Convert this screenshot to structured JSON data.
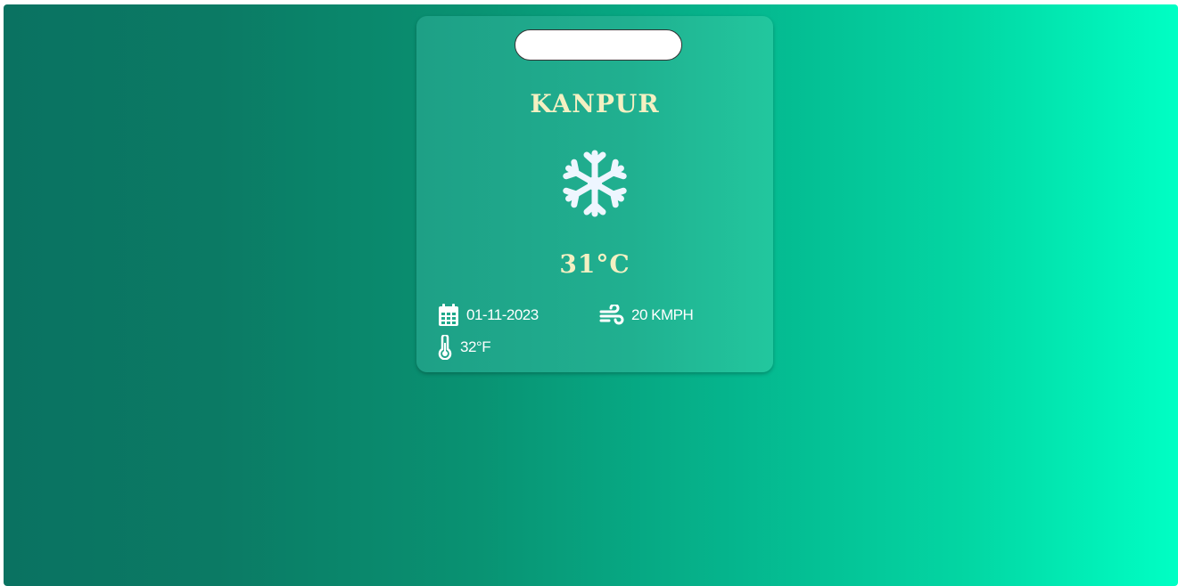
{
  "search": {
    "placeholder": "",
    "value": ""
  },
  "weather": {
    "city": "KANPUR",
    "condition_icon": "snowflake-icon",
    "temperature_c": "31°C",
    "date": "01-11-2023",
    "wind": "20 KMPH",
    "temperature_f": "32°F"
  },
  "colors": {
    "background_start": "#0a7261",
    "background_end": "#00ffc4",
    "card": "#20b090",
    "heading": "#f4f0c2",
    "icon": "#eef6ff"
  }
}
